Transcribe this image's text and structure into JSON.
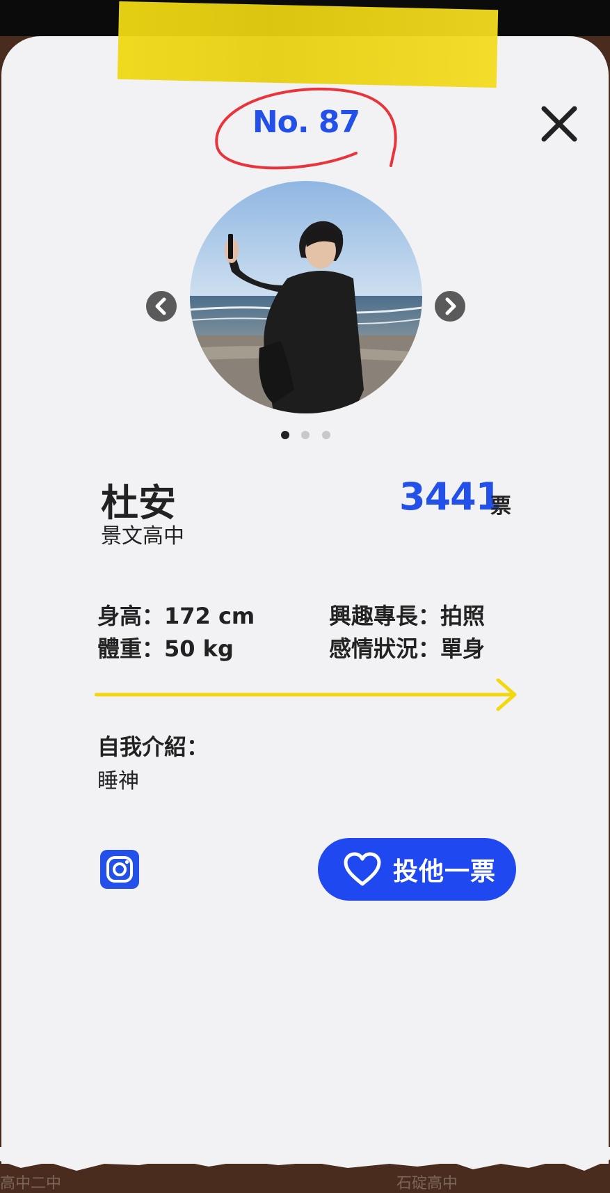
{
  "card": {
    "number": "No. 87",
    "name": "杜安",
    "school": "景文高中",
    "votes": "3441",
    "votes_unit": "票"
  },
  "carousel": {
    "total_slides": 3,
    "active_slide": 1
  },
  "stats": {
    "height": "身高：172 cm",
    "weight": "體重：50 kg",
    "hobby": "興趣專長：拍照",
    "relationship": "感情狀況：單身"
  },
  "intro": {
    "label": "自我介紹：",
    "text": "睡神"
  },
  "actions": {
    "vote_label": "投他一票"
  },
  "background": {
    "left_label": "高中二中",
    "right_label": "石碇高中"
  },
  "colors": {
    "accent": "#2350e8",
    "tape": "#f0d915",
    "circle": "#e8343a",
    "card": "#f2f1f4"
  }
}
